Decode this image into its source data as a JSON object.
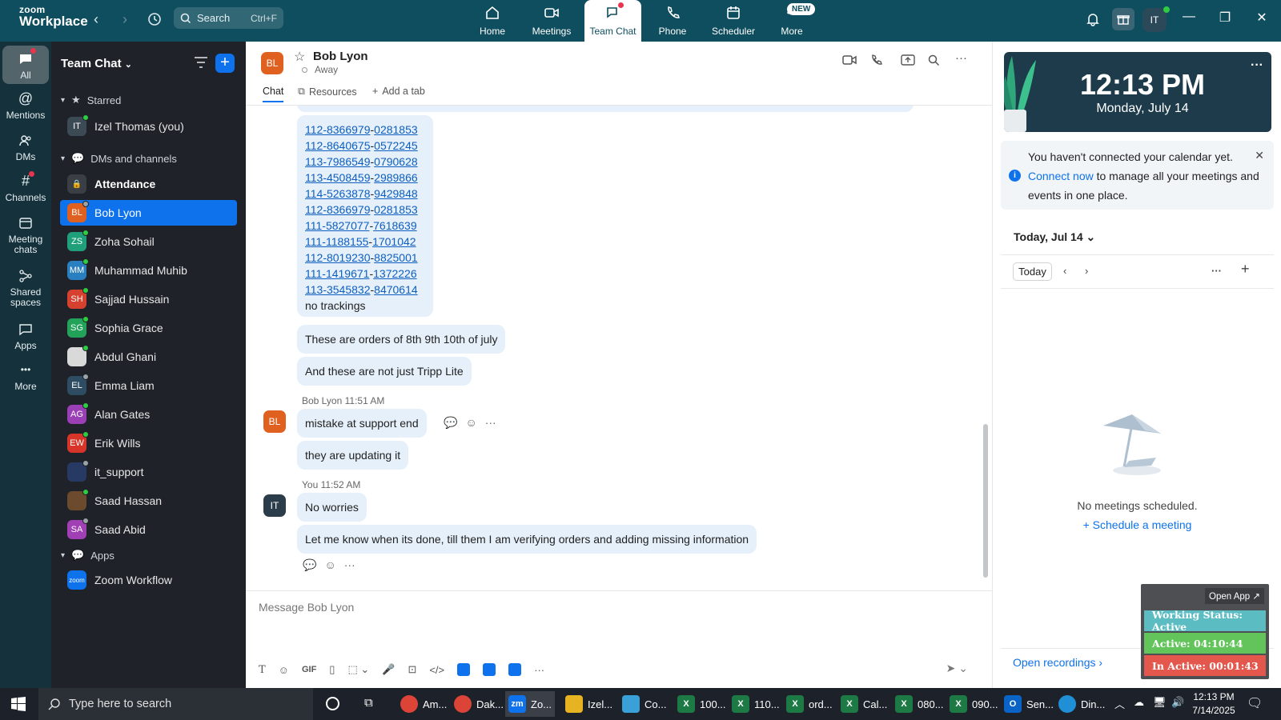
{
  "app": {
    "logo_line1": "zoom",
    "logo_line2": "Workplace",
    "search_label": "Search",
    "search_shortcut": "Ctrl+F",
    "user_initials": "IT"
  },
  "nav_tabs": [
    {
      "label": "Home",
      "icon": "home-icon"
    },
    {
      "label": "Meetings",
      "icon": "video-icon"
    },
    {
      "label": "Team Chat",
      "icon": "chat-icon",
      "active": true
    },
    {
      "label": "Phone",
      "icon": "phone-icon"
    },
    {
      "label": "Scheduler",
      "icon": "calendar-icon"
    },
    {
      "label": "More",
      "icon": "more-icon",
      "badge": "NEW"
    }
  ],
  "rail": [
    {
      "label": "All",
      "icon": "chat-bubble-icon"
    },
    {
      "label": "Mentions",
      "icon": "at-icon"
    },
    {
      "label": "DMs",
      "icon": "people-icon"
    },
    {
      "label": "Channels",
      "icon": "hash-icon"
    },
    {
      "label": "Meeting chats",
      "icon": "meeting-chat-icon"
    },
    {
      "label": "Shared spaces",
      "icon": "share-icon"
    },
    {
      "label": "Apps",
      "icon": "apps-icon"
    },
    {
      "label": "More",
      "icon": "more-icon"
    }
  ],
  "panel": {
    "title": "Team Chat",
    "starred_label": "Starred",
    "dms_label": "DMs and channels",
    "apps_label": "Apps",
    "starred": [
      {
        "initials": "IT",
        "name": "Izel Thomas (you)",
        "color": "#3b4a55",
        "presence": "#2ecc40"
      }
    ],
    "contacts": [
      {
        "initials": "",
        "name": "Attendance",
        "color": "#3a3f46",
        "bold": true
      },
      {
        "initials": "BL",
        "name": "Bob Lyon",
        "color": "#e0611f",
        "presence": "#9aa3a8",
        "active": true
      },
      {
        "initials": "ZS",
        "name": "Zoha Sohail",
        "color": "#1fa07a",
        "presence": "#2ecc40"
      },
      {
        "initials": "MM",
        "name": "Muhammad Muhib",
        "color": "#2a7fc1",
        "presence": "#2ecc40"
      },
      {
        "initials": "SH",
        "name": "Sajjad Hussain",
        "color": "#d6402f",
        "presence": "#2ecc40"
      },
      {
        "initials": "SG",
        "name": "Sophia Grace",
        "color": "#23a35a",
        "presence": "#2ecc40"
      },
      {
        "initials": "",
        "name": "Abdul Ghani",
        "color": "#d9d9d9",
        "presence": "#2ecc40"
      },
      {
        "initials": "EL",
        "name": "Emma Liam",
        "color": "#2e4d63",
        "presence": "#9aa3a8"
      },
      {
        "initials": "AG",
        "name": "Alan Gates",
        "color": "#9a3fb5",
        "presence": "#2ecc40"
      },
      {
        "initials": "EW",
        "name": "Erik Wills",
        "color": "#d8352a",
        "presence": "#2ecc40"
      },
      {
        "initials": "",
        "name": "it_support",
        "color": "#263a63",
        "presence": "#9aa3a8"
      },
      {
        "initials": "",
        "name": "Saad Hassan",
        "color": "#6b4a2e",
        "presence": "#2ecc40"
      },
      {
        "initials": "SA",
        "name": "Saad Abid",
        "color": "#a13fb5",
        "presence": "#9aa3a8"
      }
    ],
    "apps": [
      {
        "initials": "zoom",
        "name": "Zoom Workflow",
        "color": "#0e72ed"
      }
    ]
  },
  "chat": {
    "contact_initials": "BL",
    "contact_name": "Bob Lyon",
    "contact_status": "Away",
    "tabs": [
      "Chat",
      "Resources",
      "Add a tab"
    ],
    "tracking_lines": [
      [
        "112-8366979",
        "0281853"
      ],
      [
        "112-8640675",
        "0572245"
      ],
      [
        "113-7986549",
        "0790628"
      ],
      [
        "113-4508459",
        "2989866"
      ],
      [
        "114-5263878",
        "9429848"
      ],
      [
        "112-8366979",
        "0281853"
      ],
      [
        "111-5827077",
        "7618639"
      ],
      [
        "111-1188155",
        "1701042"
      ],
      [
        "112-8019230",
        "8825001"
      ],
      [
        "111-1419671",
        "1372226"
      ],
      [
        "113-3545832",
        "8470614"
      ]
    ],
    "tracking_note": "no trackings",
    "msg_orders": "These are orders of 8th 9th 10th of july",
    "msg_not_tripp": "And these are not just Tripp Lite",
    "bob_name": "Bob Lyon",
    "bob_time": "11:51 AM",
    "msg_mistake": "mistake at support end",
    "msg_updating": "they are updating it",
    "you_label": "You",
    "you_time": "11:52 AM",
    "you_initials": "IT",
    "msg_no_worries": "No worries",
    "msg_let_me_know": "Let me know when its done, till them I am verifying orders and adding missing information",
    "composer_placeholder": "Message Bob Lyon",
    "gif_label": "GIF"
  },
  "side": {
    "time": "12:13 PM",
    "date": "Monday, July 14",
    "cal_note_pre": "You haven't connected your calendar yet. ",
    "cal_note_link": "Connect now",
    "cal_note_post": " to manage all your meetings and events in one place.",
    "today_header": "Today, Jul 14",
    "today_button": "Today",
    "empty_text": "No meetings scheduled.",
    "schedule_link": "Schedule a meeting",
    "open_recordings": "Open recordings"
  },
  "work_status": {
    "open_app": "Open App ↗",
    "status": "Working Status: Active",
    "active": "Active: 04:10:44",
    "inactive": "In Active: 00:01:43",
    "colors": {
      "status": "#5bbcc2",
      "active": "#62c45a",
      "inactive": "#e4574d"
    }
  },
  "taskbar": {
    "search_placeholder": "Type here to search",
    "apps": [
      {
        "label": "Am...",
        "icon": "chrome-icon",
        "color": "#db4437"
      },
      {
        "label": "Dak...",
        "icon": "chrome-icon",
        "color": "#db4437"
      },
      {
        "label": "Zo...",
        "icon": "zoom-icon",
        "color": "#0e72ed",
        "active": true
      },
      {
        "label": "Izel...",
        "icon": "folder-icon",
        "color": "#e6b422"
      },
      {
        "label": "Co...",
        "icon": "app-icon",
        "color": "#3aa0d8"
      },
      {
        "label": "100...",
        "icon": "excel-icon",
        "color": "#1d7a45"
      },
      {
        "label": "110...",
        "icon": "excel-icon",
        "color": "#1d7a45"
      },
      {
        "label": "ord...",
        "icon": "excel-icon",
        "color": "#1d7a45"
      },
      {
        "label": "Cal...",
        "icon": "excel-icon",
        "color": "#1d7a45"
      },
      {
        "label": "080...",
        "icon": "excel-icon",
        "color": "#1d7a45"
      },
      {
        "label": "090...",
        "icon": "excel-icon",
        "color": "#1d7a45"
      },
      {
        "label": "Sen...",
        "icon": "outlook-icon",
        "color": "#0a64c8"
      },
      {
        "label": "Din...",
        "icon": "edge-icon",
        "color": "#1f8fd6"
      }
    ],
    "time": "12:13 PM",
    "date": "7/14/2025"
  }
}
